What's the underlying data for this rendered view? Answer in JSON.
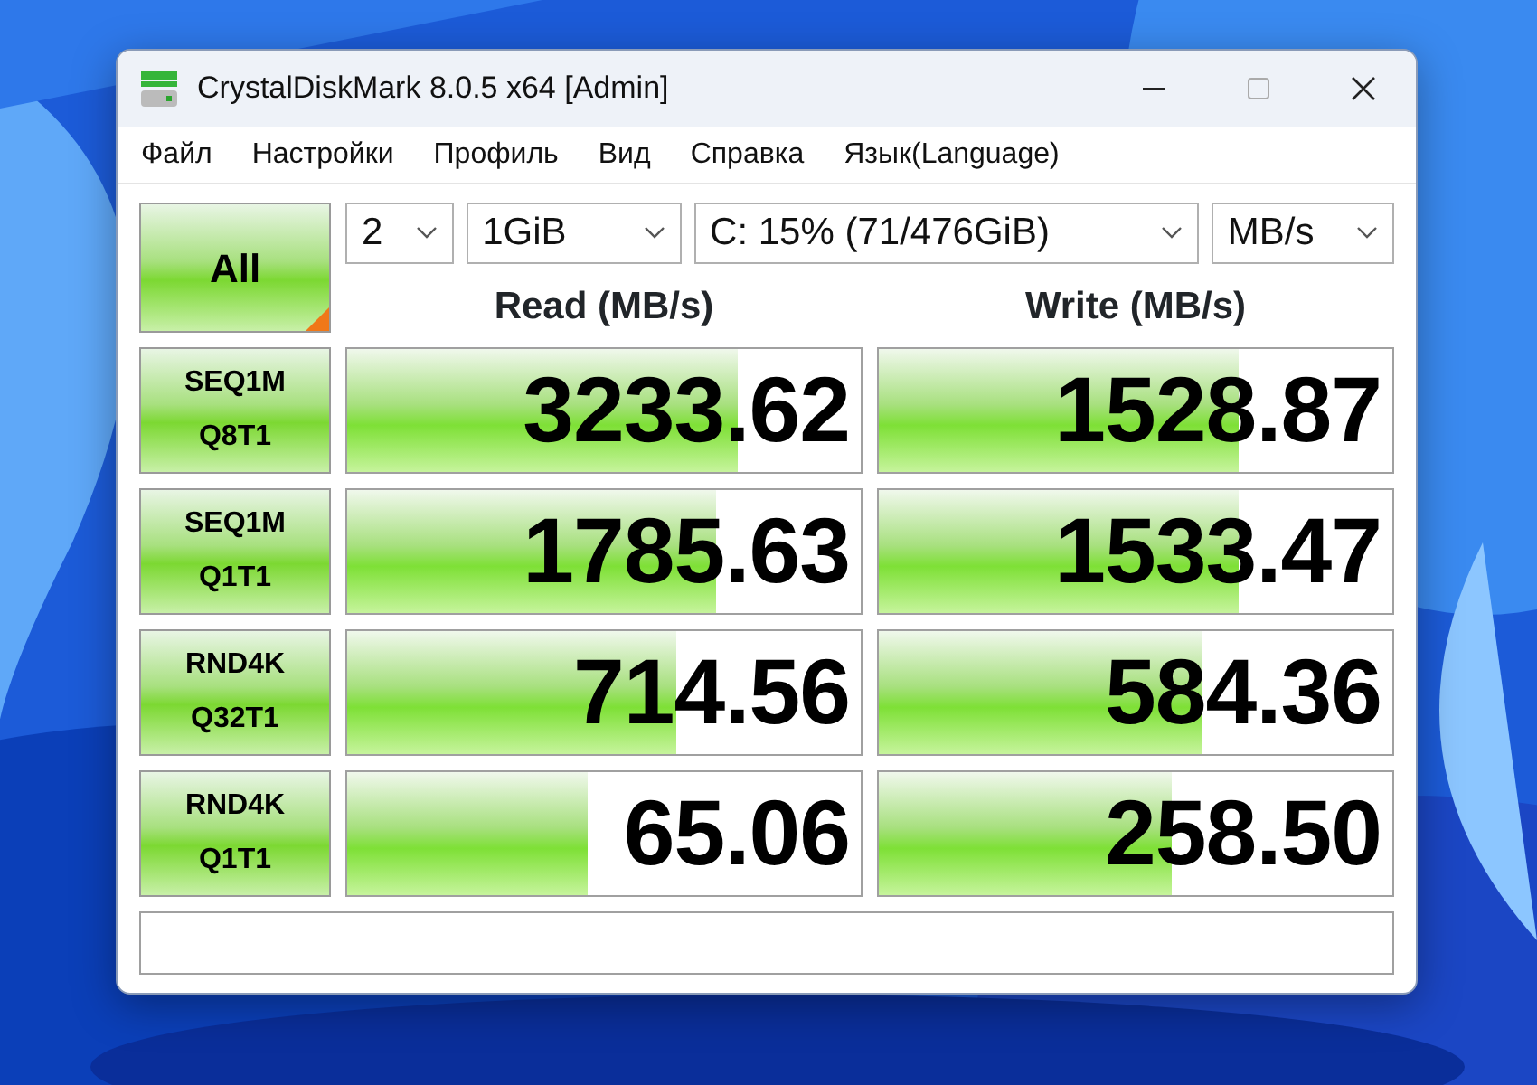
{
  "window": {
    "title": "CrystalDiskMark 8.0.5 x64 [Admin]"
  },
  "menu": [
    "Файл",
    "Настройки",
    "Профиль",
    "Вид",
    "Справка",
    "Язык(Language)"
  ],
  "all_button": "All",
  "selectors": [
    {
      "kind": "count",
      "value": "2"
    },
    {
      "kind": "size",
      "value": "1GiB"
    },
    {
      "kind": "drive",
      "value": "C: 15% (71/476GiB)"
    },
    {
      "kind": "unit",
      "value": "MB/s"
    }
  ],
  "headings": [
    "Read (MB/s)",
    "Write (MB/s)"
  ],
  "tests": [
    {
      "lines": [
        "SEQ1M",
        "Q8T1"
      ],
      "read": {
        "value": "3233.62",
        "level": 0.76
      },
      "write": {
        "value": "1528.87",
        "level": 0.7
      }
    },
    {
      "lines": [
        "SEQ1M",
        "Q1T1"
      ],
      "read": {
        "value": "1785.63",
        "level": 0.72
      },
      "write": {
        "value": "1533.47",
        "level": 0.7
      }
    },
    {
      "lines": [
        "RND4K",
        "Q32T1"
      ],
      "read": {
        "value": "714.56",
        "level": 0.64
      },
      "write": {
        "value": "584.36",
        "level": 0.63
      }
    },
    {
      "lines": [
        "RND4K",
        "Q1T1"
      ],
      "read": {
        "value": "65.06",
        "level": 0.47
      },
      "write": {
        "value": "258.50",
        "level": 0.57
      }
    }
  ]
}
